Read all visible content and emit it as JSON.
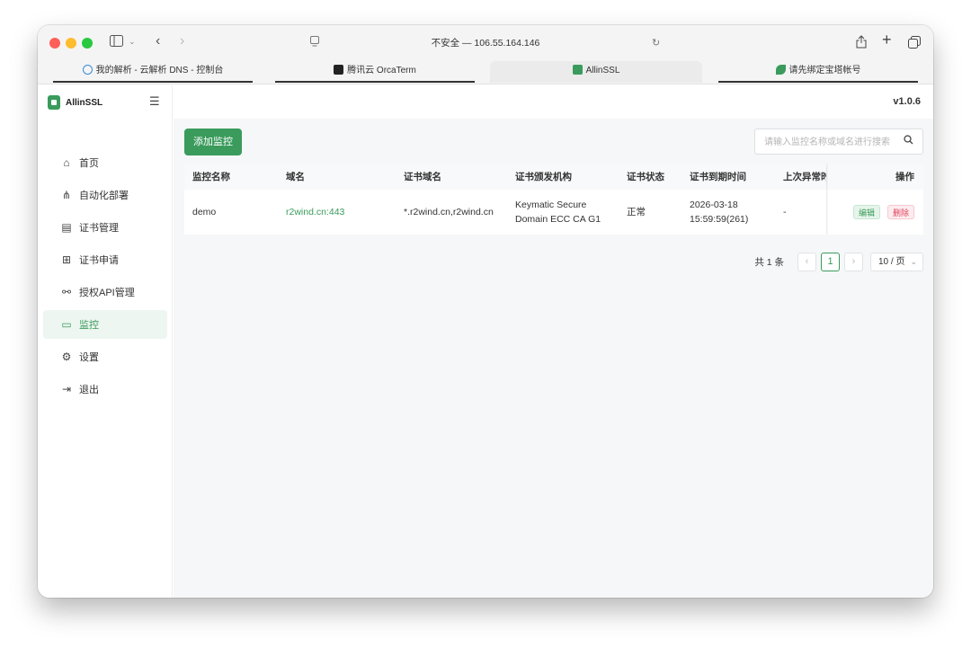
{
  "browser": {
    "address": "不安全 — 106.55.164.146",
    "tabs": [
      {
        "label": "我的解析 - 云解析 DNS - 控制台",
        "icon": "cloud-icon"
      },
      {
        "label": "腾讯云 OrcaTerm",
        "icon": "terminal-icon"
      },
      {
        "label": "AllinSSL",
        "icon": "lock-icon"
      },
      {
        "label": "请先绑定宝塔帐号",
        "icon": "leaf-icon"
      }
    ]
  },
  "app": {
    "name": "AllinSSL",
    "version": "v1.0.6",
    "accent": "#3a9b5c"
  },
  "sidebar": {
    "items": [
      {
        "label": "首页",
        "icon": "home-icon"
      },
      {
        "label": "自动化部署",
        "icon": "workflow-icon"
      },
      {
        "label": "证书管理",
        "icon": "certificate-icon"
      },
      {
        "label": "证书申请",
        "icon": "plus-square-icon"
      },
      {
        "label": "授权API管理",
        "icon": "link-icon"
      },
      {
        "label": "监控",
        "icon": "monitor-icon",
        "active": true
      },
      {
        "label": "设置",
        "icon": "gear-icon"
      },
      {
        "label": "退出",
        "icon": "logout-icon"
      }
    ]
  },
  "toolbar": {
    "add_label": "添加监控",
    "search_placeholder": "请输入监控名称或域名进行搜索"
  },
  "table": {
    "columns": [
      "监控名称",
      "域名",
      "证书域名",
      "证书颁发机构",
      "证书状态",
      "证书到期时间",
      "上次异常时间",
      "操作"
    ],
    "rows": [
      {
        "name": "demo",
        "domain": "r2wind.cn:443",
        "cert_domain": "*.r2wind.cn,r2wind.cn",
        "issuer_line1": "Keymatic Secure",
        "issuer_line2": "Domain ECC CA G1",
        "status": "正常",
        "expire_line1": "2026-03-18",
        "expire_line2": "15:59:59(261)",
        "last_error": "-",
        "edit_label": "编辑",
        "delete_label": "删除"
      }
    ]
  },
  "pagination": {
    "total": "共 1 条",
    "current": "1",
    "page_size": "10 / 页"
  }
}
